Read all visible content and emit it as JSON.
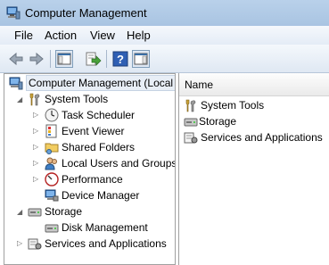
{
  "window": {
    "title": "Computer Management"
  },
  "menu": [
    "File",
    "Action",
    "View",
    "Help"
  ],
  "tree": {
    "root": "Computer Management (Local",
    "system_tools": "System Tools",
    "task_scheduler": "Task Scheduler",
    "event_viewer": "Event Viewer",
    "shared_folders": "Shared Folders",
    "local_users": "Local Users and Groups",
    "performance": "Performance",
    "device_manager": "Device Manager",
    "storage": "Storage",
    "disk_management": "Disk Management",
    "services_apps": "Services and Applications"
  },
  "list": {
    "header": "Name",
    "items": [
      "System Tools",
      "Storage",
      "Services and Applications"
    ]
  },
  "icons": {
    "back": "back-arrow-icon",
    "forward": "forward-arrow-icon",
    "show_hide_tree": "console-tree-icon",
    "export": "export-list-icon",
    "help": "help-icon",
    "action_pane": "action-pane-icon"
  }
}
